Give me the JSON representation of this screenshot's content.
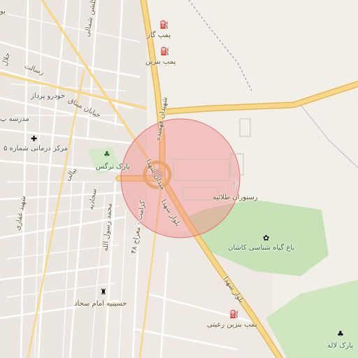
{
  "map": {
    "colors": {
      "background": "#f2efe9",
      "major_road": "#f6d888",
      "major_road_casing": "#e3b85e",
      "minor_road": "#ffffff",
      "park": "#c8e2b8",
      "highlight_circle": "#f08c8c",
      "railway": "#9a9a9a"
    },
    "labels": {
      "gas_station": "پمپ گاز",
      "petrol_station": "پمپ بنزین",
      "restaurant": "رستوران طلائیه",
      "botanical_garden": "باغ گیاه شناسی کاشان",
      "petrol_station_raeisi": "پمپ بنزین رعیتی",
      "park_laleh": "پارک لاله",
      "park_narges": "پارک نرگس",
      "husseiniyeh": "حسینیه امام سجاد",
      "clinic": "مرکز درمانی شماره ۵",
      "school": "مدرسه پ",
      "khodro_pardaz": "خودرو پرداز",
      "khiaban_mitagh": "خیابان میثاق",
      "boulevard_shohada_1": "بلوار شهدا",
      "boulevard_shohada_2": "بلوار شهدا",
      "shahidan_fahmideh": "شهیدان فهمیده",
      "meydan_shohada": "میدان شهدا",
      "shahid_ghaffari": "شهید غفاری",
      "sajjadiyeh": "سجادیه",
      "mohammad_rasool": "محمد رسول الله",
      "kerman": "کرامت - معراج ۴۸",
      "salehi": "پیالی",
      "golestan": "گلشن شمالی",
      "jalal": "جلال",
      "resalat": "رسالت",
      "bo": "بو"
    },
    "icons": {
      "fuel": "fuel-icon",
      "restaurant": "fork-knife-icon",
      "garden": "flower-icon",
      "tree": "tree-icon",
      "mosque": "mosque-icon",
      "hospital": "cross-icon"
    }
  }
}
